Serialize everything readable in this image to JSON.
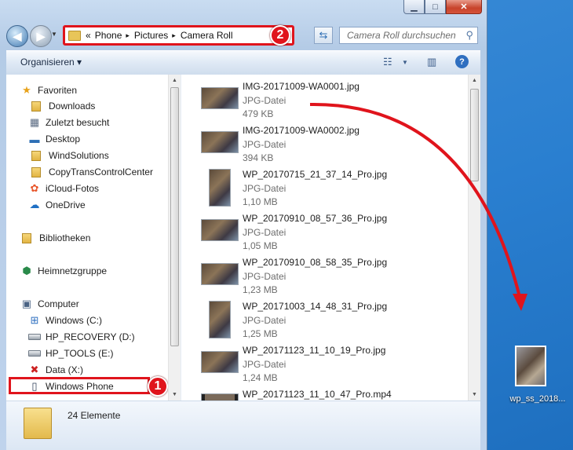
{
  "window": {
    "caption_buttons": {
      "minimize": "▁",
      "maximize": "□",
      "close": "✕"
    }
  },
  "nav": {
    "back_icon": "back-arrow-icon",
    "address": {
      "chevrons": "«",
      "crumbs": [
        "Phone",
        "Pictures",
        "Camera Roll"
      ],
      "separator": "▸"
    },
    "search_placeholder": "Camera Roll durchsuchen",
    "badge_2": "2"
  },
  "toolbar": {
    "organize_label": "Organisieren ▾"
  },
  "nav_pane": {
    "favorites": {
      "label": "Favoriten",
      "items": [
        "Downloads",
        "Zuletzt besucht",
        "Desktop",
        "WindSolutions",
        "CopyTransControlCenter",
        "iCloud-Fotos",
        "OneDrive"
      ]
    },
    "libraries": "Bibliotheken",
    "homegroup": "Heimnetzgruppe",
    "computer": {
      "label": "Computer",
      "items": [
        "Windows (C:)",
        "HP_RECOVERY (D:)",
        "HP_TOOLS (E:)",
        "Data (X:)",
        "Windows Phone"
      ]
    },
    "badge_1": "1"
  },
  "files": [
    {
      "name": "IMG-20171009-WA0001.jpg",
      "type": "JPG-Datei",
      "size": "479 KB",
      "orientation": "wide"
    },
    {
      "name": "IMG-20171009-WA0002.jpg",
      "type": "JPG-Datei",
      "size": "394 KB",
      "orientation": "wide"
    },
    {
      "name": "WP_20170715_21_37_14_Pro.jpg",
      "type": "JPG-Datei",
      "size": "1,10 MB",
      "orientation": "tall"
    },
    {
      "name": "WP_20170910_08_57_36_Pro.jpg",
      "type": "JPG-Datei",
      "size": "1,05 MB",
      "orientation": "wide"
    },
    {
      "name": "WP_20170910_08_58_35_Pro.jpg",
      "type": "JPG-Datei",
      "size": "1,23 MB",
      "orientation": "wide"
    },
    {
      "name": "WP_20171003_14_48_31_Pro.jpg",
      "type": "JPG-Datei",
      "size": "1,25 MB",
      "orientation": "tall"
    },
    {
      "name": "WP_20171123_11_10_19_Pro.jpg",
      "type": "JPG-Datei",
      "size": "1,24 MB",
      "orientation": "wide"
    },
    {
      "name": "WP_20171123_11_10_47_Pro.mp4",
      "type": "",
      "size": "",
      "orientation": "wide"
    }
  ],
  "status": {
    "count": "24 Elemente"
  },
  "desktop": {
    "file_label": "wp_ss_2018..."
  },
  "colors": {
    "highlight_red": "#e0141c",
    "window_frame": "#bfd3ec"
  }
}
